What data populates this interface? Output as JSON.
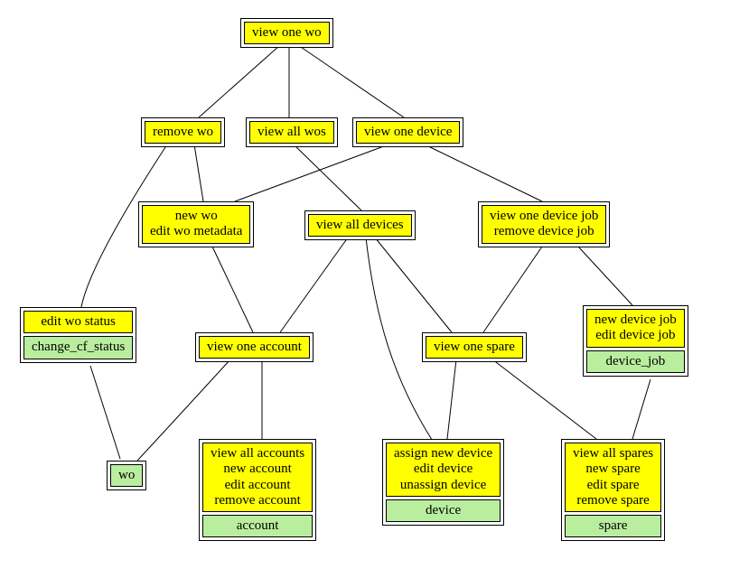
{
  "chart_data": {
    "type": "tree",
    "title": "",
    "nodes": [
      {
        "id": "view_one_wo",
        "cells": [
          {
            "text": "view one wo",
            "color": "yellow"
          }
        ]
      },
      {
        "id": "remove_wo",
        "cells": [
          {
            "text": "remove wo",
            "color": "yellow"
          }
        ]
      },
      {
        "id": "view_all_wos",
        "cells": [
          {
            "text": "view all wos",
            "color": "yellow"
          }
        ]
      },
      {
        "id": "view_one_device",
        "cells": [
          {
            "text": "view one device",
            "color": "yellow"
          }
        ]
      },
      {
        "id": "new_wo",
        "cells": [
          {
            "text": "new wo\nedit wo metadata",
            "color": "yellow"
          }
        ]
      },
      {
        "id": "view_all_devices",
        "cells": [
          {
            "text": "view all devices",
            "color": "yellow"
          }
        ]
      },
      {
        "id": "view_one_device_job",
        "cells": [
          {
            "text": "view one device job\nremove device job",
            "color": "yellow"
          }
        ]
      },
      {
        "id": "edit_wo_status",
        "cells": [
          {
            "text": "edit wo status",
            "color": "yellow"
          },
          {
            "text": "change_cf_status",
            "color": "green"
          }
        ]
      },
      {
        "id": "view_one_account",
        "cells": [
          {
            "text": "view one account",
            "color": "yellow"
          }
        ]
      },
      {
        "id": "view_one_spare",
        "cells": [
          {
            "text": "view one spare",
            "color": "yellow"
          }
        ]
      },
      {
        "id": "new_device_job",
        "cells": [
          {
            "text": "new device job\nedit device job",
            "color": "yellow"
          },
          {
            "text": "device_job",
            "color": "green"
          }
        ]
      },
      {
        "id": "wo",
        "cells": [
          {
            "text": "wo",
            "color": "green"
          }
        ]
      },
      {
        "id": "accounts",
        "cells": [
          {
            "text": "view all accounts\nnew account\nedit account\nremove account",
            "color": "yellow"
          },
          {
            "text": "account",
            "color": "green"
          }
        ]
      },
      {
        "id": "devices",
        "cells": [
          {
            "text": "assign new device\nedit device\nunassign device",
            "color": "yellow"
          },
          {
            "text": "device",
            "color": "green"
          }
        ]
      },
      {
        "id": "spares",
        "cells": [
          {
            "text": "view all spares\nnew spare\nedit spare\nremove spare",
            "color": "yellow"
          },
          {
            "text": "spare",
            "color": "green"
          }
        ]
      }
    ],
    "edges": [
      [
        "view_one_wo",
        "remove_wo"
      ],
      [
        "view_one_wo",
        "view_all_wos"
      ],
      [
        "view_one_wo",
        "view_one_device"
      ],
      [
        "remove_wo",
        "edit_wo_status"
      ],
      [
        "remove_wo",
        "new_wo"
      ],
      [
        "view_all_wos",
        "view_all_devices"
      ],
      [
        "view_one_device",
        "new_wo"
      ],
      [
        "view_one_device",
        "view_one_device_job"
      ],
      [
        "new_wo",
        "view_one_account"
      ],
      [
        "view_all_devices",
        "view_one_account"
      ],
      [
        "view_all_devices",
        "view_one_spare"
      ],
      [
        "view_all_devices",
        "devices"
      ],
      [
        "view_one_device_job",
        "view_one_spare"
      ],
      [
        "view_one_device_job",
        "new_device_job"
      ],
      [
        "edit_wo_status",
        "wo"
      ],
      [
        "view_one_account",
        "wo"
      ],
      [
        "view_one_account",
        "accounts"
      ],
      [
        "view_one_spare",
        "devices"
      ],
      [
        "view_one_spare",
        "spares"
      ],
      [
        "new_device_job",
        "spares"
      ]
    ]
  },
  "n": {
    "view_one_wo": "view one wo",
    "remove_wo": "remove wo",
    "view_all_wos": "view all wos",
    "view_one_device": "view one device",
    "new_wo": "new wo\nedit wo metadata",
    "view_all_devices": "view all devices",
    "view_one_device_job": "view one device job\nremove device job",
    "edit_wo_status_0": "edit wo status",
    "edit_wo_status_1": "change_cf_status",
    "view_one_account": "view one account",
    "view_one_spare": "view one spare",
    "new_device_job_0": "new device job\nedit device job",
    "new_device_job_1": "device_job",
    "wo": "wo",
    "accounts_0": "view all accounts\nnew account\nedit account\nremove account",
    "accounts_1": "account",
    "devices_0": "assign new device\nedit device\nunassign device",
    "devices_1": "device",
    "spares_0": "view all spares\nnew spare\nedit spare\nremove spare",
    "spares_1": "spare"
  }
}
